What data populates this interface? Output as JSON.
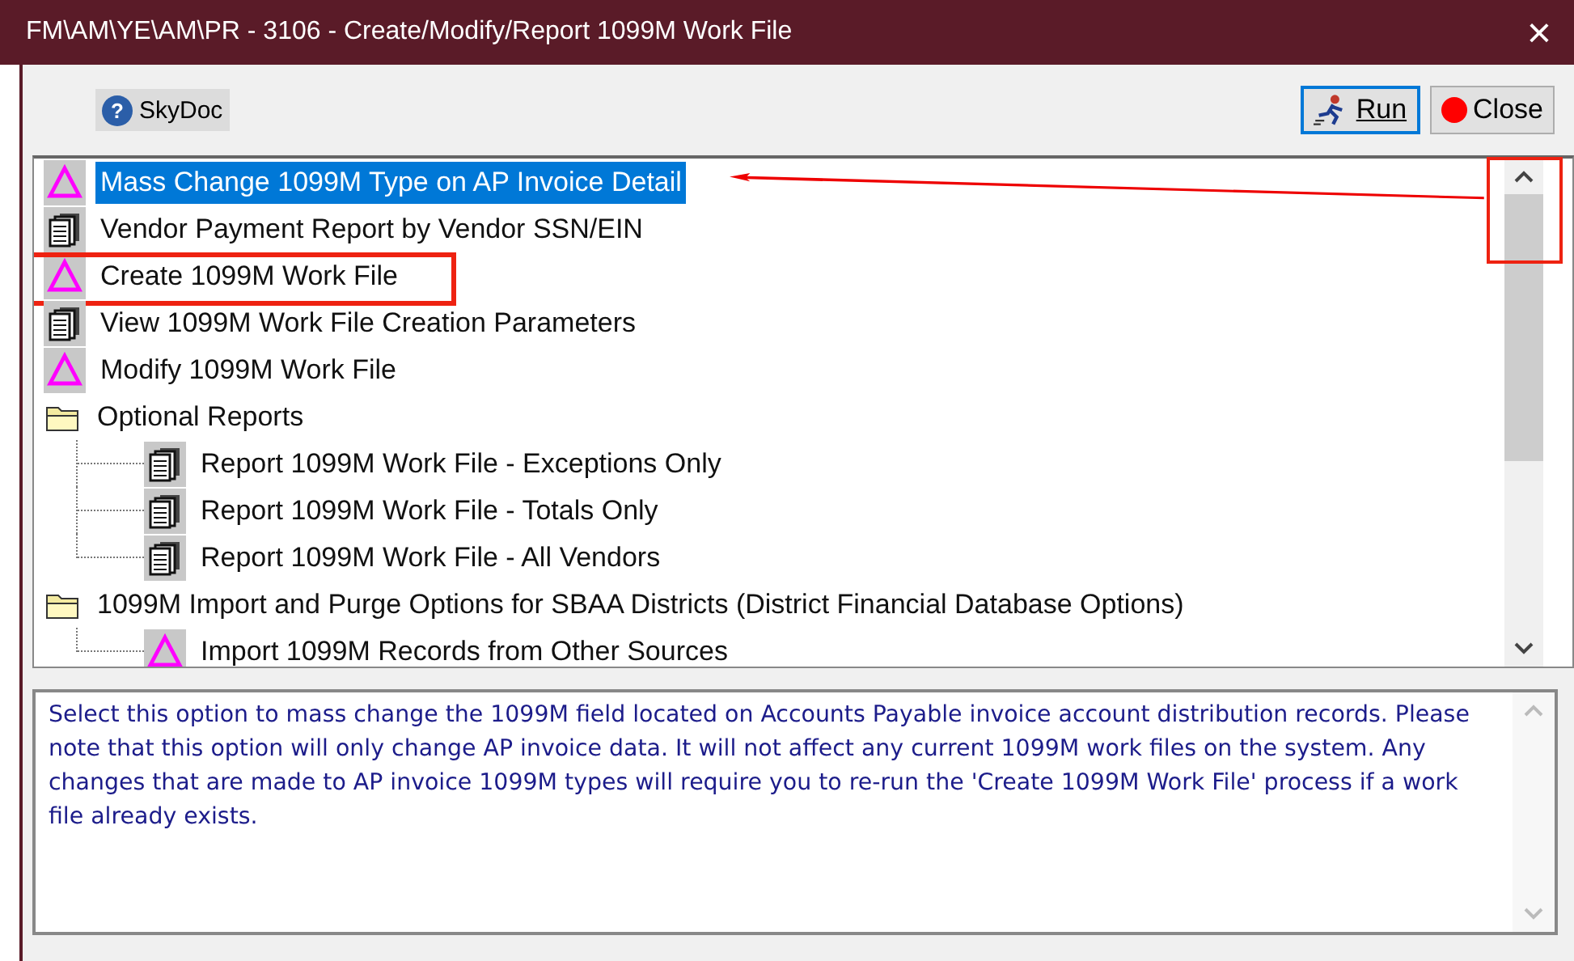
{
  "window": {
    "title": "FM\\AM\\YE\\AM\\PR - 3106 - Create/Modify/Report 1099M Work File",
    "close": "×"
  },
  "toolbar": {
    "help_button": "SkyDoc",
    "help_glyph": "?",
    "run_button": "Run",
    "close_button": "Close"
  },
  "tree": [
    {
      "kind": "task",
      "label": "Mass Change 1099M Type on AP Invoice Detail",
      "selected": true,
      "boxed": false
    },
    {
      "kind": "report",
      "label": "Vendor Payment Report by Vendor SSN/EIN",
      "selected": false,
      "boxed": false
    },
    {
      "kind": "task",
      "label": "Create 1099M Work File",
      "selected": false,
      "boxed": true
    },
    {
      "kind": "report",
      "label": "View 1099M Work File Creation Parameters",
      "selected": false,
      "boxed": false
    },
    {
      "kind": "task",
      "label": "Modify 1099M Work File",
      "selected": false,
      "boxed": false
    },
    {
      "kind": "folder",
      "label": "Optional Reports",
      "selected": false,
      "boxed": false,
      "children": [
        {
          "kind": "report",
          "label": "Report 1099M Work File - Exceptions Only",
          "selected": false,
          "boxed": false
        },
        {
          "kind": "report",
          "label": "Report 1099M Work File - Totals Only",
          "selected": false,
          "boxed": false
        },
        {
          "kind": "report",
          "label": "Report 1099M Work File - All Vendors",
          "selected": false,
          "boxed": false
        }
      ]
    },
    {
      "kind": "folder",
      "label": "1099M Import and Purge Options for SBAA Districts (District Financial Database Options)",
      "selected": false,
      "boxed": false,
      "children": [
        {
          "kind": "task",
          "label": "Import 1099M Records from Other Sources",
          "selected": false,
          "boxed": false
        }
      ]
    }
  ],
  "description": "Select this option to mass change the 1099M field located on Accounts Payable invoice account distribution records. Please note that this option will only change AP invoice data. It will not affect any current 1099M work files on the system. Any changes that are made to AP invoice 1099M types will require you to re-run the 'Create 1099M Work File' process if a work file already exists."
}
